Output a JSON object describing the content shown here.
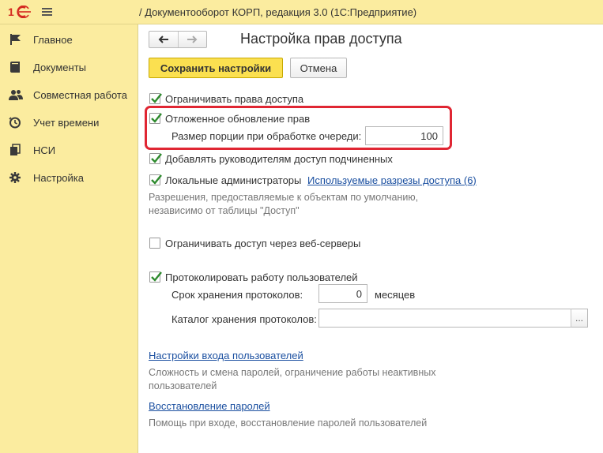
{
  "app": {
    "title": "/ Документооборот КОРП, редакция 3.0  (1С:Предприятие)",
    "logo_text": "1С"
  },
  "sidebar": {
    "items": [
      {
        "label": "Главное",
        "icon": "flag-icon"
      },
      {
        "label": "Документы",
        "icon": "documents-icon"
      },
      {
        "label": "Совместная работа",
        "icon": "people-icon"
      },
      {
        "label": "Учет времени",
        "icon": "clock-icon"
      },
      {
        "label": "НСИ",
        "icon": "books-icon"
      },
      {
        "label": "Настройка",
        "icon": "gear-icon"
      }
    ]
  },
  "page": {
    "title": "Настройка прав доступа",
    "back_icon": "arrow-left-icon",
    "forward_icon": "arrow-right-icon"
  },
  "toolbar": {
    "save_label": "Сохранить настройки",
    "cancel_label": "Отмена"
  },
  "settings": {
    "restrict_rights": {
      "label": "Ограничивать права доступа",
      "checked": true
    },
    "deferred_update": {
      "label": "Отложенное обновление прав",
      "checked": true
    },
    "batch_size": {
      "label": "Размер порции при обработке очереди:",
      "value": "100"
    },
    "add_managers": {
      "label": "Добавлять руководителям доступ подчиненных",
      "checked": true
    },
    "local_admins": {
      "label": "Локальные администраторы",
      "checked": true,
      "link": "Используемые разрезы доступа (6)"
    },
    "local_admins_note_1": "Разрешения, предоставляемые к объектам по умолчанию,",
    "local_admins_note_2": "независимо от таблицы \"Доступ\"",
    "web_servers": {
      "label": "Ограничивать доступ через веб-серверы",
      "checked": false
    },
    "log_users": {
      "label": "Протоколировать работу пользователей",
      "checked": true
    },
    "log_retention": {
      "label": "Срок хранения протоколов:",
      "value": "0",
      "unit": "месяцев"
    },
    "log_catalog": {
      "label": "Каталог хранения протоколов:",
      "value": "",
      "button": "..."
    },
    "login_settings": {
      "link": "Настройки входа пользователей",
      "note_1": "Сложность и смена паролей, ограничение работы неактивных",
      "note_2": "пользователей"
    },
    "password_recovery": {
      "link": "Восстановление паролей",
      "note": "Помощь при входе, восстановление паролей пользователей"
    }
  },
  "colors": {
    "accent_yellow": "#fbe050",
    "sidebar_bg": "#fbec9f",
    "link": "#1a4fa0",
    "highlight_red": "#e02633",
    "check_green": "#2e8b2e"
  }
}
